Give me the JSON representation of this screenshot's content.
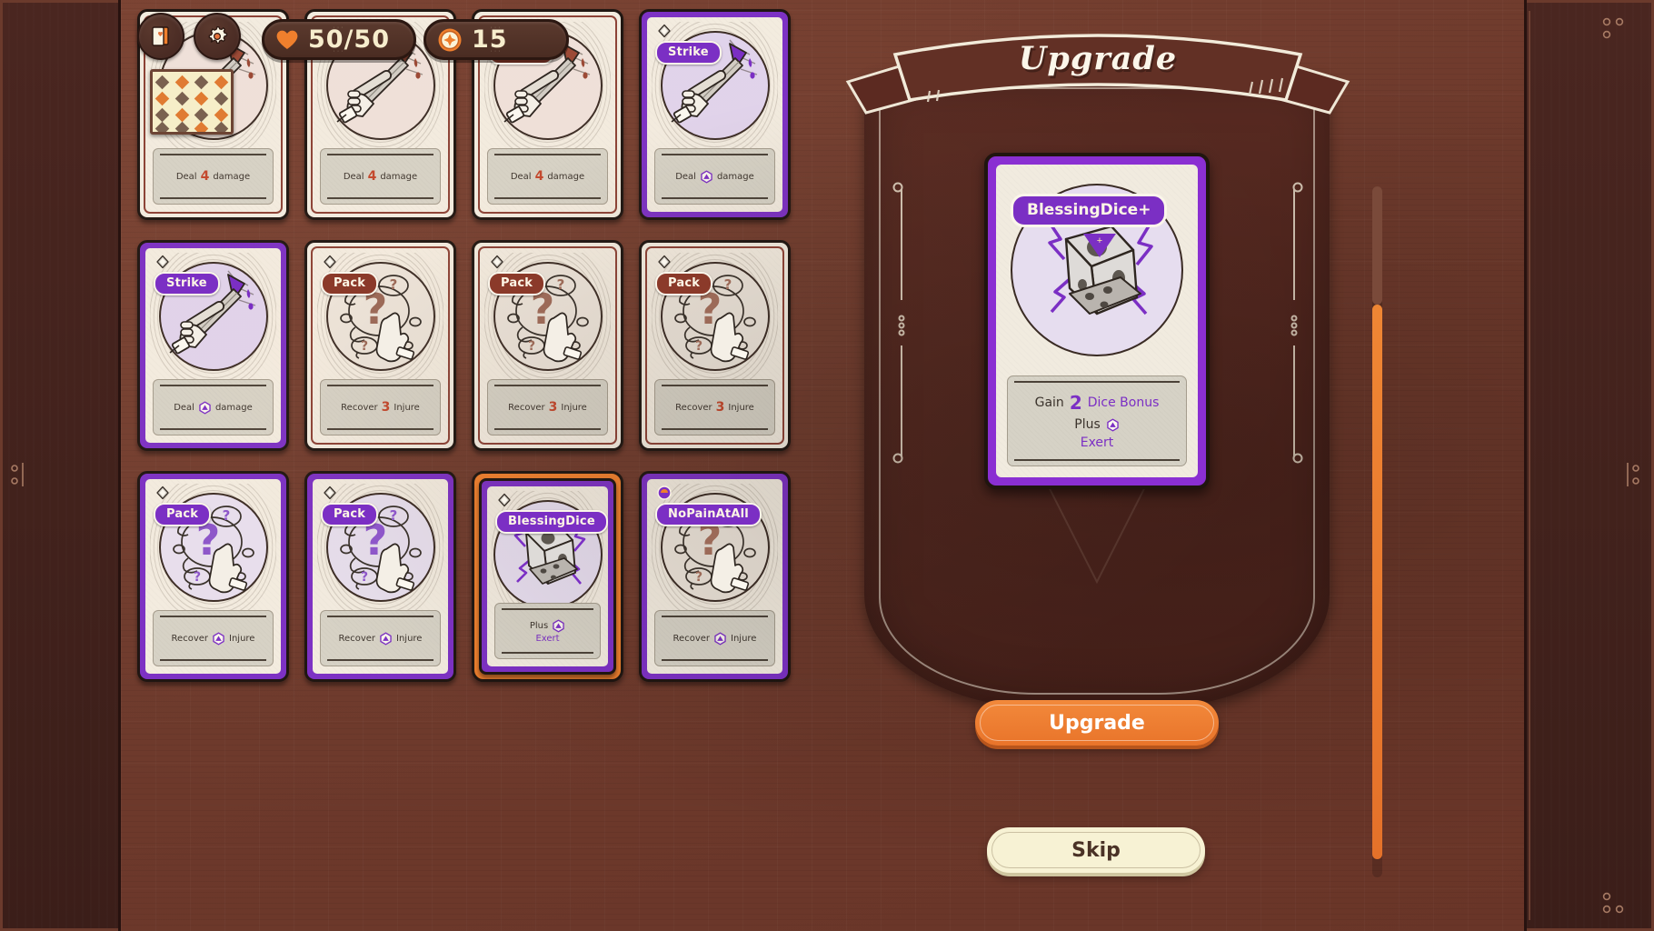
{
  "hud": {
    "deck_button": "deck-icon",
    "settings_button": "gear-icon",
    "map_thumbnail": "map-icon",
    "hp_label": "50/50",
    "gold_label": "15"
  },
  "grid": {
    "cards": [
      {
        "name": "",
        "cost": "1",
        "rarity": "common",
        "art": "sword",
        "desc_prefix": "Deal",
        "desc_value": "4",
        "desc_suffix": "damage",
        "desc_value_type": "number",
        "hidden_name": true
      },
      {
        "name": "",
        "cost": "1",
        "rarity": "common",
        "art": "sword",
        "desc_prefix": "Deal",
        "desc_value": "4",
        "desc_suffix": "damage",
        "desc_value_type": "number",
        "hidden_name": true
      },
      {
        "name": "Strike",
        "cost": "1",
        "rarity": "common",
        "art": "sword",
        "desc_prefix": "Deal",
        "desc_value": "4",
        "desc_suffix": "damage",
        "desc_value_type": "number"
      },
      {
        "name": "Strike",
        "cost": "1",
        "rarity": "upgraded",
        "art": "sword",
        "desc_prefix": "Deal",
        "desc_value": "",
        "desc_suffix": "damage",
        "desc_value_type": "die"
      },
      {
        "name": "Strike",
        "cost": "1",
        "rarity": "upgraded",
        "art": "sword",
        "desc_prefix": "Deal",
        "desc_value": "",
        "desc_suffix": "damage",
        "desc_value_type": "die"
      },
      {
        "name": "Pack",
        "cost": "1",
        "rarity": "common",
        "art": "question",
        "desc_prefix": "Recover",
        "desc_value": "3",
        "desc_suffix": "Injure",
        "desc_value_type": "number"
      },
      {
        "name": "Pack",
        "cost": "1",
        "rarity": "common",
        "art": "question",
        "desc_prefix": "Recover",
        "desc_value": "3",
        "desc_suffix": "Injure",
        "desc_value_type": "number"
      },
      {
        "name": "Pack",
        "cost": "1",
        "rarity": "common",
        "art": "question",
        "desc_prefix": "Recover",
        "desc_value": "3",
        "desc_suffix": "Injure",
        "desc_value_type": "number"
      },
      {
        "name": "Pack",
        "cost": "1",
        "rarity": "upgraded",
        "art": "question-purple",
        "desc_prefix": "Recover",
        "desc_value": "",
        "desc_suffix": "Injure",
        "desc_value_type": "die"
      },
      {
        "name": "Pack",
        "cost": "1",
        "rarity": "upgraded",
        "art": "question-purple",
        "desc_prefix": "Recover",
        "desc_value": "",
        "desc_suffix": "Injure",
        "desc_value_type": "die"
      },
      {
        "name": "BlessingDice",
        "cost": "1",
        "rarity": "upgraded",
        "art": "dice",
        "selected": true,
        "desc_prefix": "Plus",
        "desc_value": "",
        "desc_suffix": "",
        "desc_value_type": "die",
        "desc_keyword": "Exert"
      },
      {
        "name": "NoPainAtAll",
        "cost": "orb",
        "rarity": "upgraded",
        "art": "question",
        "desc_prefix": "Recover",
        "desc_value": "",
        "desc_suffix": "Injure",
        "desc_value_type": "die"
      }
    ]
  },
  "panel": {
    "banner_title": "Upgrade",
    "preview_card": {
      "name": "BlessingDice+",
      "upgrade_marker": "+",
      "desc_line1_prefix": "Gain",
      "desc_line1_value": "2",
      "desc_line1_suffix": "Dice Bonus",
      "desc_line2_prefix": "Plus",
      "desc_line2_keyword": "Exert"
    },
    "upgrade_button": "Upgrade",
    "skip_button": "Skip"
  },
  "colors": {
    "accent_orange": "#ef7f2d",
    "upgrade_purple": "#7b2fc4",
    "common_red": "#8b3a2a",
    "panel_brown": "#5a2b22",
    "cream": "#f7f2d4"
  }
}
